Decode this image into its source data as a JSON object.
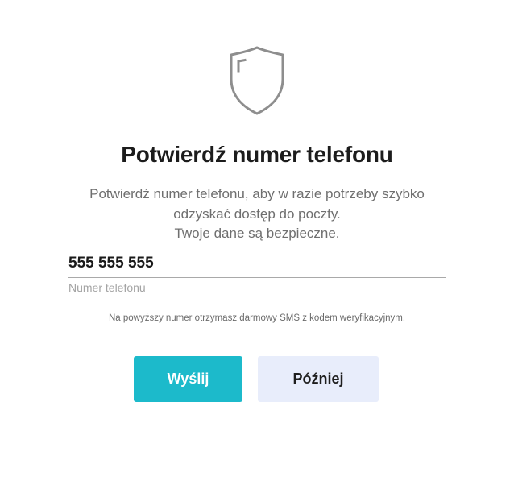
{
  "dialog": {
    "icon": "shield-icon",
    "title": "Potwierdź numer telefonu",
    "description_lines": [
      "Potwierdź numer telefonu, aby w razie potrzeby szybko",
      "odzyskać dostęp do poczty.",
      "Twoje dane są bezpieczne."
    ],
    "phone": {
      "value": "555 555 555",
      "label": "Numer telefonu"
    },
    "sms_note": "Na powyższy numer otrzymasz darmowy SMS z kodem weryfikacyjnym.",
    "buttons": {
      "send_label": "Wyślij",
      "later_label": "Później"
    },
    "colors": {
      "primary": "#1cbacb",
      "secondary": "#e8edfb",
      "icon_stroke": "#8e8e8e"
    }
  }
}
